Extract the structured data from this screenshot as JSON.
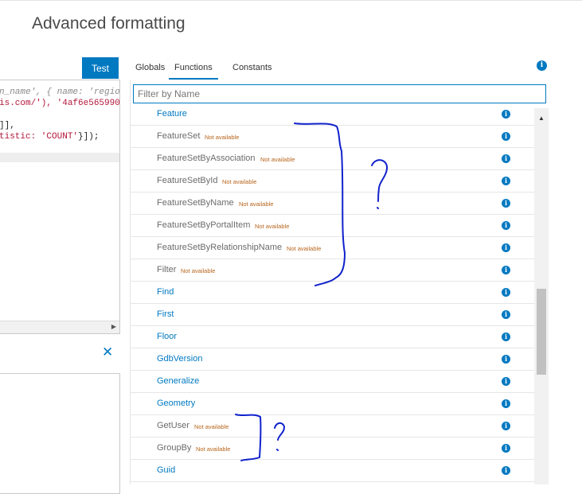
{
  "header": {
    "title": "Advanced formatting"
  },
  "toolbar": {
    "test_label": "Test"
  },
  "editor": {
    "lines": [
      {
        "cm": "n_name', { name: 'regio",
        "str": "",
        "pl": ""
      },
      {
        "cm": "",
        "str": "is.com/'), '4af6e565990",
        "pl": ""
      },
      {
        "cm": "",
        "str": "",
        "pl": "]],"
      },
      {
        "cm": "",
        "str": "tistic: 'COUNT'",
        "pl": "}]);"
      }
    ]
  },
  "close_glyph": "✕",
  "tabs": [
    {
      "label": "Globals",
      "active": false
    },
    {
      "label": "Functions",
      "active": true
    },
    {
      "label": "Constants",
      "active": false
    }
  ],
  "filter": {
    "placeholder": "Filter by Name",
    "value": ""
  },
  "not_available_text": "Not available",
  "functions": [
    {
      "name": "Feature",
      "available": true
    },
    {
      "name": "FeatureSet",
      "available": false
    },
    {
      "name": "FeatureSetByAssociation",
      "available": false
    },
    {
      "name": "FeatureSetById",
      "available": false
    },
    {
      "name": "FeatureSetByName",
      "available": false
    },
    {
      "name": "FeatureSetByPortalItem",
      "available": false
    },
    {
      "name": "FeatureSetByRelationshipName",
      "available": false
    },
    {
      "name": "Filter",
      "available": false
    },
    {
      "name": "Find",
      "available": true
    },
    {
      "name": "First",
      "available": true
    },
    {
      "name": "Floor",
      "available": true
    },
    {
      "name": "GdbVersion",
      "available": true
    },
    {
      "name": "Generalize",
      "available": true
    },
    {
      "name": "Geometry",
      "available": true
    },
    {
      "name": "GetUser",
      "available": false
    },
    {
      "name": "GroupBy",
      "available": false
    },
    {
      "name": "Guid",
      "available": true
    }
  ],
  "colors": {
    "accent": "#0079c1",
    "not_available": "#b7641b",
    "annotation_ink": "#1122cc"
  },
  "icons": {
    "info": "info-icon",
    "close": "close-icon",
    "scroll_up": "chevron-up-icon",
    "scroll_right": "chevron-right-icon"
  }
}
